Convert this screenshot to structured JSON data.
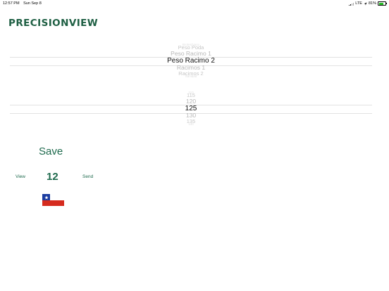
{
  "status_bar": {
    "time": "12:57 PM",
    "date": "Sun Sep 8",
    "network": "LTE",
    "battery_percent": "81%",
    "battery_level": 0.81,
    "battery_color": "#2bc12b"
  },
  "app": {
    "logo_text": "PRECISIONVIEW",
    "brand_color": "#1e5f43"
  },
  "picker_field": {
    "rows": [
      {
        "label": "Brotes/Vaso"
      },
      {
        "label": "Peso Poda"
      },
      {
        "label": "Peso Racimo 1"
      },
      {
        "label": "Peso Racimo 2"
      },
      {
        "label": "Racimos 1"
      },
      {
        "label": "Racimos 2"
      },
      {
        "label": "Sanidad"
      }
    ],
    "selected_index": 3
  },
  "picker_value": {
    "rows": [
      {
        "label": "110"
      },
      {
        "label": "115"
      },
      {
        "label": "120"
      },
      {
        "label": "125"
      },
      {
        "label": "130"
      },
      {
        "label": "135"
      },
      {
        "label": "140"
      }
    ],
    "selected_index": 3
  },
  "actions": {
    "save_label": "Save",
    "view_label": "View",
    "send_label": "Send",
    "count": "12"
  },
  "language_flag": {
    "icon": "chile-flag-icon",
    "colors": {
      "blue": "#1b3ca0",
      "red": "#d52b1e",
      "white": "#ffffff"
    }
  }
}
